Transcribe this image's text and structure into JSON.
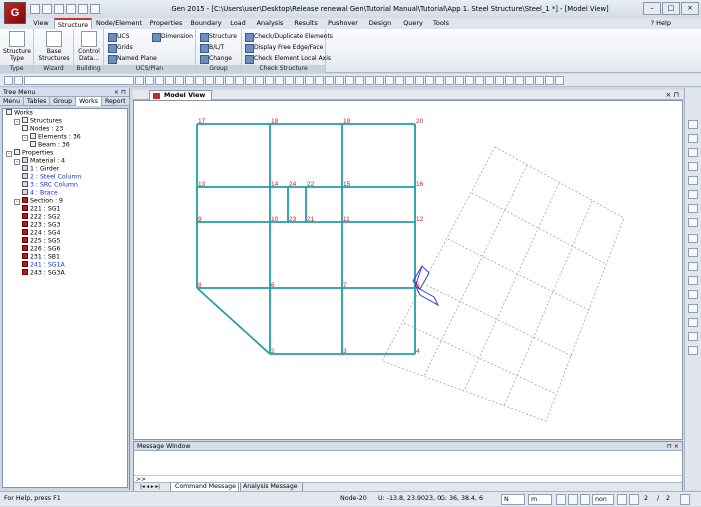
{
  "window": {
    "title": "Gen 2015 - [C:\\Users\\user\\Desktop\\Release renewal Gen\\Tutorial Manual\\Tutorial\\App 1. Steel Structure\\Steel_1 *] - [Model View]",
    "app_logo": "G"
  },
  "ribbon_tabs": [
    "View",
    "Structure",
    "Node/Element",
    "Properties",
    "Boundary",
    "Load",
    "Analysis",
    "Results",
    "Pushover",
    "Design",
    "Query",
    "Tools"
  ],
  "active_tab": "Structure",
  "help_label": "Help",
  "ribbon": {
    "groups": [
      {
        "label": "Type"
      },
      {
        "label": "Wizard"
      },
      {
        "label": "Building"
      },
      {
        "label": "UCS/Plan"
      },
      {
        "label": "Group"
      },
      {
        "label": "Check Structure"
      }
    ],
    "structure_type": "Structure\nType",
    "base_structures": "Base\nStructures",
    "control_data": "Control\nData...",
    "ucs": "UCS",
    "grids": "Grids",
    "named_plane": "Named Plane",
    "dimension": "Dimension",
    "structure": "Structure",
    "blt": "B/L/T",
    "change": "Change",
    "check_dup": "Check/Duplicate Elements",
    "free_edge": "Display Free Edge/Face",
    "local_axis": "Check Element Local Axis"
  },
  "tree": {
    "title": "Tree Menu",
    "tabs": [
      "Menu",
      "Tables",
      "Group",
      "Works",
      "Report"
    ],
    "active_tab": "Works",
    "items": [
      {
        "text": "Works",
        "level": 0,
        "color": "black",
        "icon": "folder-icon",
        "toggle": ""
      },
      {
        "text": "Structures",
        "level": 1,
        "color": "black",
        "icon": "folder-icon",
        "toggle": "-"
      },
      {
        "text": "Nodes : 23",
        "level": 2,
        "color": "black",
        "icon": "node-icon",
        "toggle": ""
      },
      {
        "text": "Elements : 36",
        "level": 2,
        "color": "black",
        "icon": "element-icon",
        "toggle": "-"
      },
      {
        "text": "Beam : 36",
        "level": 3,
        "color": "black",
        "icon": "beam-icon",
        "toggle": ""
      },
      {
        "text": "Properties",
        "level": 0,
        "color": "black",
        "icon": "folder-icon",
        "toggle": "-"
      },
      {
        "text": "Material : 4",
        "level": 1,
        "color": "black",
        "icon": "material-icon",
        "toggle": "-"
      },
      {
        "text": "1 : Girder",
        "level": 2,
        "color": "black",
        "icon": "material-icon",
        "toggle": ""
      },
      {
        "text": "2 : Steel Column",
        "level": 2,
        "color": "blue",
        "icon": "material-icon",
        "toggle": ""
      },
      {
        "text": "3 : SRC Column",
        "level": 2,
        "color": "blue",
        "icon": "material-icon",
        "toggle": ""
      },
      {
        "text": "4 : Brace",
        "level": 2,
        "color": "blue",
        "icon": "material-icon",
        "toggle": ""
      },
      {
        "text": "Section : 9",
        "level": 1,
        "color": "black",
        "icon": "section-icon",
        "toggle": "-"
      },
      {
        "text": "221 : SG1",
        "level": 2,
        "color": "black",
        "icon": "section-icon",
        "toggle": ""
      },
      {
        "text": "222 : SG2",
        "level": 2,
        "color": "black",
        "icon": "section-icon",
        "toggle": ""
      },
      {
        "text": "223 : SG3",
        "level": 2,
        "color": "black",
        "icon": "section-icon",
        "toggle": ""
      },
      {
        "text": "224 : SG4",
        "level": 2,
        "color": "black",
        "icon": "section-icon",
        "toggle": ""
      },
      {
        "text": "225 : SG5",
        "level": 2,
        "color": "black",
        "icon": "section-icon",
        "toggle": ""
      },
      {
        "text": "226 : SG6",
        "level": 2,
        "color": "black",
        "icon": "section-icon",
        "toggle": ""
      },
      {
        "text": "231 : SB1",
        "level": 2,
        "color": "black",
        "icon": "section-icon",
        "toggle": ""
      },
      {
        "text": "241 : SG1A",
        "level": 2,
        "color": "blue",
        "icon": "section-icon",
        "toggle": ""
      },
      {
        "text": "243 : SG3A",
        "level": 2,
        "color": "black",
        "icon": "section-icon",
        "toggle": ""
      }
    ]
  },
  "model_view": {
    "tab_label": "Model View",
    "node_labels": [
      "17",
      "18",
      "19",
      "20",
      "13",
      "14",
      "24",
      "22",
      "15",
      "16",
      "9",
      "10",
      "23",
      "21",
      "11",
      "12",
      "8",
      "6",
      "7",
      "5",
      "2",
      "3",
      "4"
    ]
  },
  "message_window": {
    "title": "Message Window",
    "prompt": ">>",
    "tabs": [
      "Command Message",
      "Analysis Message"
    ],
    "active_tab": "Command Message"
  },
  "status": {
    "help_text": "For Help, press F1",
    "node": "Node-20",
    "ucs": "U: -13.8, 23.9023, 0",
    "global": "G: 36, 38.4, 6",
    "unit_force": "N",
    "unit_length": "m",
    "display_mode": "non",
    "page_current": "2",
    "page_total": "2"
  },
  "colors": {
    "member": "#1f9fa6",
    "node_label": "#c0242a",
    "tree_blue": "#1b2fd0",
    "accent_red": "#c0392b"
  }
}
